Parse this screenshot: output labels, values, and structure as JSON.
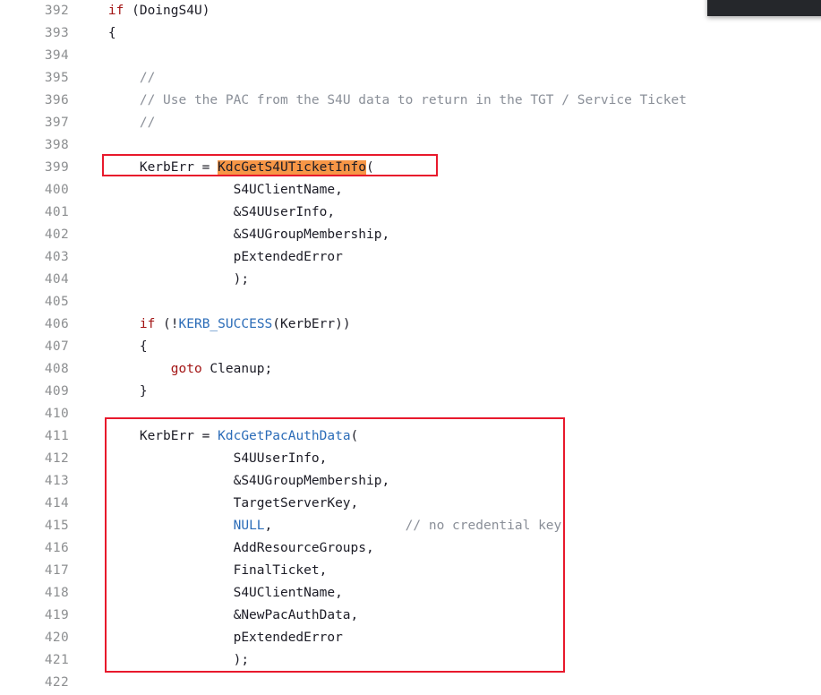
{
  "editor": {
    "language": "c",
    "first_line_number": 392,
    "colors": {
      "background": "#ffffff",
      "line_number": "#8d8f91",
      "text": "#1c1c26",
      "keyword": "#a31515",
      "identifier_type": "#2b6cb8",
      "comment": "#8a8f98",
      "highlight_background": "#f79646",
      "annotation_box": "#e8192c",
      "overlay_panel": "#25272b"
    },
    "lines": [
      {
        "number": "392",
        "tokens": [
          {
            "text": "    ",
            "type": "plain"
          },
          {
            "text": "if",
            "type": "keyword"
          },
          {
            "text": " (DoingS4U)",
            "type": "plain"
          }
        ]
      },
      {
        "number": "393",
        "tokens": [
          {
            "text": "    {",
            "type": "plain"
          }
        ]
      },
      {
        "number": "394",
        "tokens": [
          {
            "text": "",
            "type": "plain"
          }
        ]
      },
      {
        "number": "395",
        "tokens": [
          {
            "text": "        ",
            "type": "plain"
          },
          {
            "text": "//",
            "type": "comment"
          }
        ]
      },
      {
        "number": "396",
        "tokens": [
          {
            "text": "        ",
            "type": "plain"
          },
          {
            "text": "// Use the PAC from the S4U data to return in the TGT / Service Ticket",
            "type": "comment"
          }
        ]
      },
      {
        "number": "397",
        "tokens": [
          {
            "text": "        ",
            "type": "plain"
          },
          {
            "text": "//",
            "type": "comment"
          }
        ]
      },
      {
        "number": "398",
        "tokens": [
          {
            "text": "",
            "type": "plain"
          }
        ]
      },
      {
        "number": "399",
        "tokens": [
          {
            "text": "        KerbErr = ",
            "type": "plain"
          },
          {
            "text": "KdcGetS4UTicketInfo",
            "type": "highlight"
          },
          {
            "text": "(",
            "type": "plain"
          }
        ]
      },
      {
        "number": "400",
        "tokens": [
          {
            "text": "                    S4UClientName,",
            "type": "plain"
          }
        ]
      },
      {
        "number": "401",
        "tokens": [
          {
            "text": "                    &S4UUserInfo,",
            "type": "plain"
          }
        ]
      },
      {
        "number": "402",
        "tokens": [
          {
            "text": "                    &S4UGroupMembership,",
            "type": "plain"
          }
        ]
      },
      {
        "number": "403",
        "tokens": [
          {
            "text": "                    pExtendedError",
            "type": "plain"
          }
        ]
      },
      {
        "number": "404",
        "tokens": [
          {
            "text": "                    );",
            "type": "plain"
          }
        ]
      },
      {
        "number": "405",
        "tokens": [
          {
            "text": "",
            "type": "plain"
          }
        ]
      },
      {
        "number": "406",
        "tokens": [
          {
            "text": "        ",
            "type": "plain"
          },
          {
            "text": "if",
            "type": "keyword"
          },
          {
            "text": " (!",
            "type": "plain"
          },
          {
            "text": "KERB_SUCCESS",
            "type": "type"
          },
          {
            "text": "(KerbErr))",
            "type": "plain"
          }
        ]
      },
      {
        "number": "407",
        "tokens": [
          {
            "text": "        {",
            "type": "plain"
          }
        ]
      },
      {
        "number": "408",
        "tokens": [
          {
            "text": "            ",
            "type": "plain"
          },
          {
            "text": "goto",
            "type": "keyword"
          },
          {
            "text": " Cleanup;",
            "type": "plain"
          }
        ]
      },
      {
        "number": "409",
        "tokens": [
          {
            "text": "        }",
            "type": "plain"
          }
        ]
      },
      {
        "number": "410",
        "tokens": [
          {
            "text": "",
            "type": "plain"
          }
        ]
      },
      {
        "number": "411",
        "tokens": [
          {
            "text": "        KerbErr = ",
            "type": "plain"
          },
          {
            "text": "KdcGetPacAuthData",
            "type": "type"
          },
          {
            "text": "(",
            "type": "plain"
          }
        ]
      },
      {
        "number": "412",
        "tokens": [
          {
            "text": "                    S4UUserInfo,",
            "type": "plain"
          }
        ]
      },
      {
        "number": "413",
        "tokens": [
          {
            "text": "                    &S4UGroupMembership,",
            "type": "plain"
          }
        ]
      },
      {
        "number": "414",
        "tokens": [
          {
            "text": "                    TargetServerKey,",
            "type": "plain"
          }
        ]
      },
      {
        "number": "415",
        "tokens": [
          {
            "text": "                    ",
            "type": "plain"
          },
          {
            "text": "NULL",
            "type": "type"
          },
          {
            "text": ",                 ",
            "type": "plain"
          },
          {
            "text": "// no credential key",
            "type": "comment"
          }
        ]
      },
      {
        "number": "416",
        "tokens": [
          {
            "text": "                    AddResourceGroups,",
            "type": "plain"
          }
        ]
      },
      {
        "number": "417",
        "tokens": [
          {
            "text": "                    FinalTicket,",
            "type": "plain"
          }
        ]
      },
      {
        "number": "418",
        "tokens": [
          {
            "text": "                    S4UClientName,",
            "type": "plain"
          }
        ]
      },
      {
        "number": "419",
        "tokens": [
          {
            "text": "                    &NewPacAuthData,",
            "type": "plain"
          }
        ]
      },
      {
        "number": "420",
        "tokens": [
          {
            "text": "                    pExtendedError",
            "type": "plain"
          }
        ]
      },
      {
        "number": "421",
        "tokens": [
          {
            "text": "                    );",
            "type": "plain"
          }
        ]
      },
      {
        "number": "422",
        "tokens": [
          {
            "text": "",
            "type": "plain"
          }
        ]
      }
    ]
  },
  "annotations": [
    {
      "id": "annot-box-upper",
      "label": "highlight-box-kdcgets4uticketinfo-call"
    },
    {
      "id": "annot-box-lower",
      "label": "highlight-box-kdcgetpacauthdata-call"
    }
  ]
}
